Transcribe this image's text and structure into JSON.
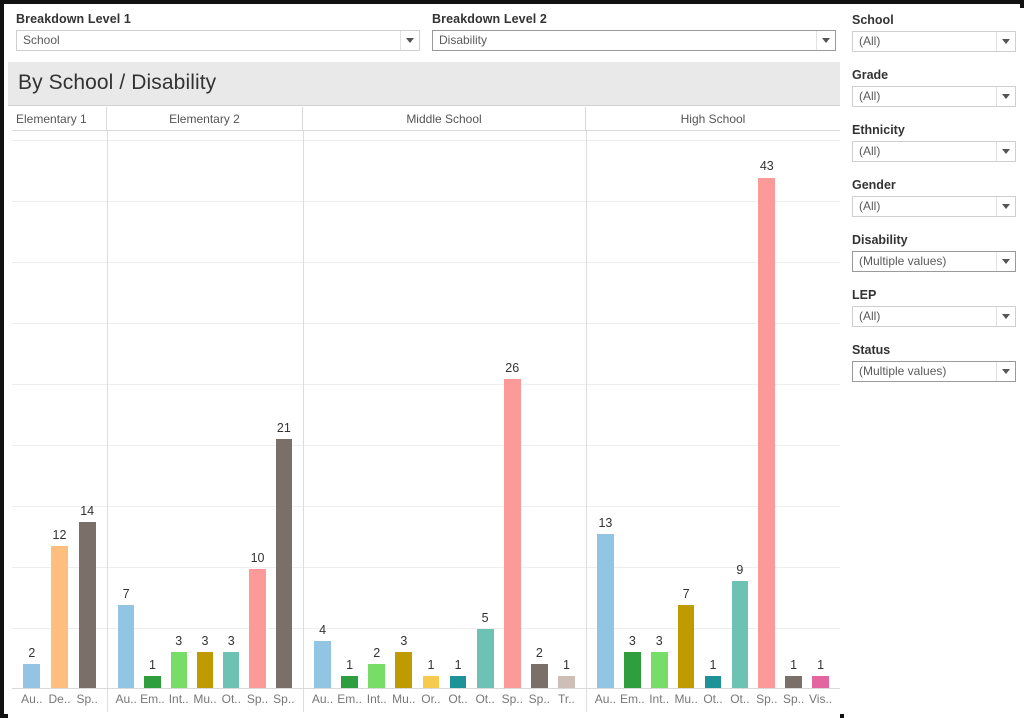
{
  "breakdown_controls": [
    {
      "label": "Breakdown Level 1",
      "value": "School",
      "icon": "chevron-down-icon"
    },
    {
      "label": "Breakdown Level 2",
      "value": "Disability",
      "icon": "chevron-down-icon"
    }
  ],
  "chart_panel": {
    "title": "By School / Disability"
  },
  "filters": [
    {
      "label": "School",
      "value": "(All)"
    },
    {
      "label": "Grade",
      "value": "(All)"
    },
    {
      "label": "Ethnicity",
      "value": "(All)"
    },
    {
      "label": "Gender",
      "value": "(All)"
    },
    {
      "label": "Disability",
      "value": "(Multiple values)"
    },
    {
      "label": "LEP",
      "value": "(All)"
    },
    {
      "label": "Status",
      "value": "(Multiple values)"
    }
  ],
  "chart_data": {
    "type": "bar",
    "title": "By School / Disability",
    "xlabel": "",
    "ylabel": "",
    "ylim": [
      0,
      47
    ],
    "grid": true,
    "legend": "none",
    "groups": [
      {
        "name": "Elementary 1",
        "bars": [
          {
            "tick": "Au..",
            "value": 2,
            "color": "#92c5e3"
          },
          {
            "tick": "De..",
            "value": 12,
            "color": "#ffbe7d"
          },
          {
            "tick": "Sp..",
            "value": 14,
            "color": "#7b6f6a"
          }
        ]
      },
      {
        "name": "Elementary 2",
        "bars": [
          {
            "tick": "Au..",
            "value": 7,
            "color": "#92c5e3"
          },
          {
            "tick": "Em..",
            "value": 1,
            "color": "#2e9e3e"
          },
          {
            "tick": "Int..",
            "value": 3,
            "color": "#77dd66"
          },
          {
            "tick": "Mu..",
            "value": 3,
            "color": "#bf9b00"
          },
          {
            "tick": "Ot..",
            "value": 3,
            "color": "#6dc2b4"
          },
          {
            "tick": "Sp..",
            "value": 10,
            "color": "#fb9a99"
          },
          {
            "tick": "Sp..",
            "value": 21,
            "color": "#7b6f6a"
          }
        ]
      },
      {
        "name": "Middle School",
        "bars": [
          {
            "tick": "Au..",
            "value": 4,
            "color": "#92c5e3"
          },
          {
            "tick": "Em..",
            "value": 1,
            "color": "#2e9e3e"
          },
          {
            "tick": "Int..",
            "value": 2,
            "color": "#77dd66"
          },
          {
            "tick": "Mu..",
            "value": 3,
            "color": "#bf9b00"
          },
          {
            "tick": "Or..",
            "value": 1,
            "color": "#f7ca4d"
          },
          {
            "tick": "Ot..",
            "value": 1,
            "color": "#1d9397"
          },
          {
            "tick": "Ot..",
            "value": 5,
            "color": "#6dc2b4"
          },
          {
            "tick": "Sp..",
            "value": 26,
            "color": "#fb9a99"
          },
          {
            "tick": "Sp..",
            "value": 2,
            "color": "#7b6f6a"
          },
          {
            "tick": "Tr..",
            "value": 1,
            "color": "#cdbfb8"
          }
        ]
      },
      {
        "name": "High School",
        "bars": [
          {
            "tick": "Au..",
            "value": 13,
            "color": "#92c5e3"
          },
          {
            "tick": "Em..",
            "value": 3,
            "color": "#2e9e3e"
          },
          {
            "tick": "Int..",
            "value": 3,
            "color": "#77dd66"
          },
          {
            "tick": "Mu..",
            "value": 7,
            "color": "#bf9b00"
          },
          {
            "tick": "Ot..",
            "value": 1,
            "color": "#1d9397"
          },
          {
            "tick": "Ot..",
            "value": 9,
            "color": "#6dc2b4"
          },
          {
            "tick": "Sp..",
            "value": 43,
            "color": "#fb9a99"
          },
          {
            "tick": "Sp..",
            "value": 1,
            "color": "#7b6f6a"
          },
          {
            "tick": "Vis..",
            "value": 1,
            "color": "#e3679e"
          }
        ]
      }
    ]
  }
}
